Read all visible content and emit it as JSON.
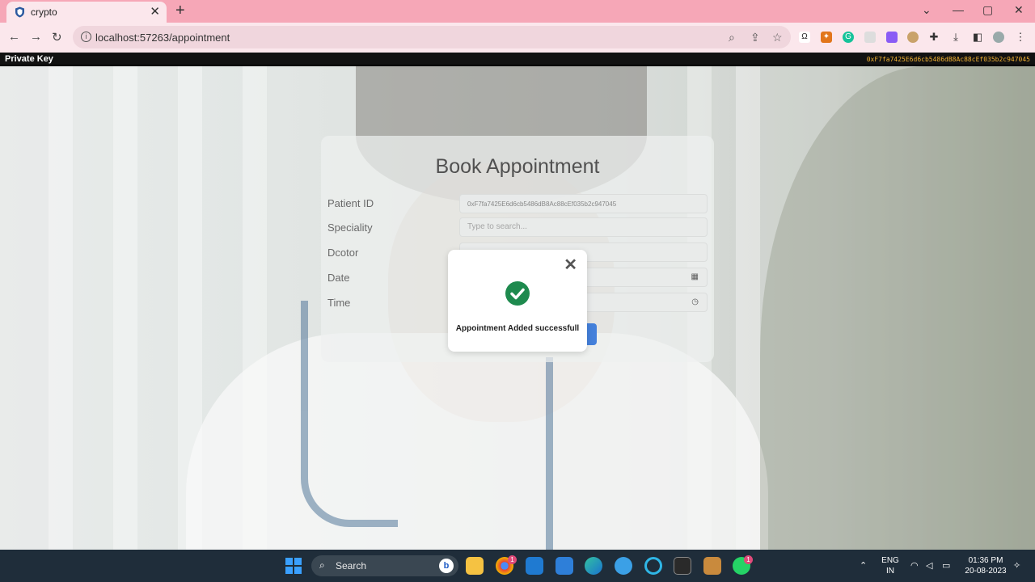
{
  "browser": {
    "tab_title": "crypto",
    "tab_close": "✕",
    "new_tab": "+",
    "url": "localhost:57263/appointment",
    "window_controls": {
      "dropdown": "⌄",
      "minimize": "—",
      "maximize": "▢",
      "close": "✕"
    }
  },
  "header": {
    "label": "Private Key",
    "value": "0xF7fa7425E6d6cb5486dB8Ac88cEf035b2c947045"
  },
  "form": {
    "title": "Book Appointment",
    "patient_id_label": "Patient ID",
    "patient_id_value": "0xF7fa7425E6d6cb5486dB8Ac88cEf035b2c947045",
    "speciality_label": "Speciality",
    "speciality_placeholder": "Type to search...",
    "doctor_label": "Dcotor",
    "date_label": "Date",
    "time_label": "Time"
  },
  "alert": {
    "close": "✕",
    "message": "Appointment Added successfull"
  },
  "taskbar": {
    "search_label": "Search",
    "search_badge": "b",
    "chrome_badge": "1",
    "whatsapp_badge": "1",
    "language": "ENG",
    "region": "IN",
    "time": "01:36 PM",
    "date": "20-08-2023"
  },
  "colors": {
    "tab_bar": "#f6a7b7",
    "toolbar": "#fbe7ec",
    "key_value": "#f2b233",
    "success_green": "#1e8a4e",
    "button_blue": "#2b6fd6",
    "taskbar": "#1f2d3a"
  }
}
